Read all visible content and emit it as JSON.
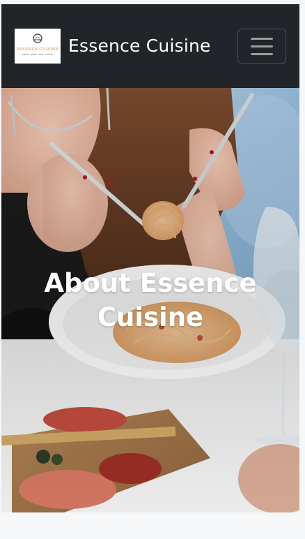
{
  "navbar": {
    "logo": {
      "name": "ESSENCE CUISINE",
      "tagline": "pasta · pizza · vino · cucina",
      "icon": "cloche-icon"
    },
    "brand_name": "Essence Cuisine",
    "toggler_icon": "hamburger-menu-icon"
  },
  "hero": {
    "title": "About Essence Cuisine",
    "image": "woman-eating-spaghetti-photo"
  },
  "colors": {
    "navbar_bg": "#212529",
    "page_bg": "#f6f7f9",
    "hero_title": "#ffffff",
    "logo_accent": "#c58b4a"
  }
}
